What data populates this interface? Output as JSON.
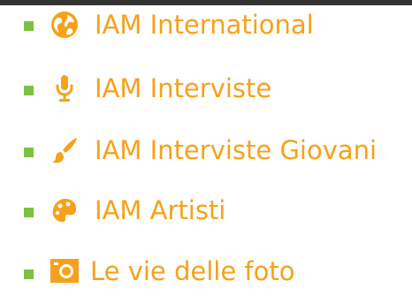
{
  "colors": {
    "accent": "#f7a11a",
    "bullet": "#7fc041",
    "topbar": "#333333",
    "background": "#ffffff"
  },
  "menu": {
    "items": [
      {
        "label": "IAM International",
        "icon": "globe-icon"
      },
      {
        "label": "IAM Interviste",
        "icon": "microphone-icon"
      },
      {
        "label": "IAM Interviste Giovani",
        "icon": "paintbrush-icon"
      },
      {
        "label": "IAM Artisti",
        "icon": "palette-icon"
      },
      {
        "label": "Le vie delle foto",
        "icon": "camera-icon"
      }
    ]
  }
}
